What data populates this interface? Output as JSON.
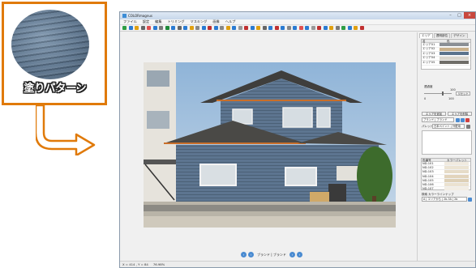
{
  "callout": {
    "label": "塗りパターン",
    "swatch_color": "#5b738c",
    "border_color": "#e07a0a"
  },
  "window": {
    "title": "COLORmagnus",
    "close_icon": "×",
    "max_icon": "□",
    "min_icon": "–"
  },
  "menu": [
    "ファイル",
    "設定",
    "編集",
    "トリミング",
    "マスキング",
    "画像",
    "ヘルプ"
  ],
  "toolbar_icons": [
    "#2f9e44",
    "#2b7bd1",
    "#e0a010",
    "#666666",
    "#e05050",
    "#2b7bd1",
    "#7a7a7a",
    "#1f8a3a",
    "#2b7bd1",
    "#666666",
    "#2b7bd1",
    "#e0a010",
    "#888888",
    "#2b7bd1",
    "#c03030",
    "#2b7bd1",
    "#888888",
    "#e0a010",
    "#2b7bd1",
    "#999999",
    "#c03030",
    "#2b7bd1",
    "#e0a010",
    "#666666",
    "#2b7bd1",
    "#c03030",
    "#2b7bd1",
    "#888888",
    "#2b7bd1",
    "#e05050",
    "#2b7bd1",
    "#999999",
    "#c03030",
    "#2b7bd1",
    "#e0a010",
    "#7a7a7a",
    "#2f9e44",
    "#2b7bd1",
    "#e0a010",
    "#c03030"
  ],
  "canvas": {
    "pattern_name": "ブランド | ブランド",
    "prev_icon": "‹",
    "next_icon": "›"
  },
  "status": {
    "coords": "X = 414 , Y = 84",
    "zoom": "76.98%"
  },
  "panel": {
    "tabs": [
      "エリア",
      "透明部位",
      "デザイン"
    ],
    "area_table": {
      "headers": [
        "名",
        "色"
      ],
      "rows": [
        {
          "name": "エリア01",
          "color": "#8a8f95"
        },
        {
          "name": "エリア02",
          "color": "#c9b08a"
        },
        {
          "name": "エリア03",
          "color": "#5b738c"
        },
        {
          "name": "エリア04",
          "color": "#d9d5cc"
        },
        {
          "name": "エリア05",
          "color": "#6f6d68"
        }
      ]
    },
    "opacity_label": "透過度",
    "opacity_max": "100",
    "opacity_min": "0",
    "opacity_max2": "100",
    "opacity_value": 0.68,
    "reset_button": "リセット",
    "add_area_button": "エリアを追加",
    "delete_area_button": "エリアを削除",
    "pattern_select": "ブランド | ブランド",
    "palette_label": "パレット",
    "palette_select": "日本ペイント | 外壁用",
    "palette_table": {
      "headers": [
        "色番号",
        "カラーパレット"
      ],
      "rows": [
        {
          "code": "ND-101",
          "color": "#f1ebe0"
        },
        {
          "code": "ND-102",
          "color": "#ece4d3"
        },
        {
          "code": "ND-103",
          "color": "#e6dcc8"
        },
        {
          "code": "ND-104",
          "color": "#e2d4bc"
        },
        {
          "code": "ND-105",
          "color": "#ded0b6"
        },
        {
          "code": "ND-106",
          "color": "#ebe2d0"
        },
        {
          "code": "ND-107",
          "color": "#f2ede4"
        }
      ]
    },
    "search_label": "検索 カラーラインナップ",
    "search_select": "A | エリアから | 2b-3A | 2b"
  }
}
